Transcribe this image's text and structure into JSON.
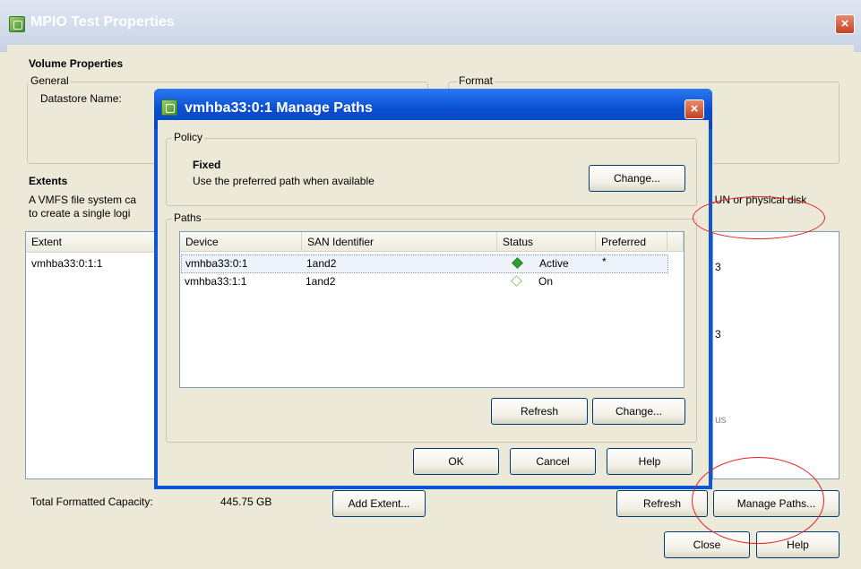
{
  "outer_window": {
    "title": "MPIO Test Properties",
    "volume_properties_heading": "Volume Properties",
    "general_label": "General",
    "datastore_name_label": "Datastore Name:",
    "format_label": "Format",
    "extents_heading": "Extents",
    "extents_desc_line1": "A VMFS file system ca",
    "extents_desc_line2": "to create a single logi",
    "extents_desc_right": "LUN or physical disk",
    "extent_column": "Extent",
    "extent_rows": [
      "vmhba33:0:1:1"
    ],
    "partial_glyph_1": "3",
    "partial_glyph_2": "3",
    "partial_text_us": "us",
    "total_capacity_label": "Total Formatted Capacity:",
    "total_capacity_value": "445.75 GB",
    "add_extent_button": "Add Extent...",
    "refresh_button": "Refresh",
    "manage_paths_button": "Manage Paths...",
    "close_button": "Close",
    "help_button": "Help",
    "close_x": "×"
  },
  "dialog": {
    "title": "vmhba33:0:1 Manage Paths",
    "close_x": "×",
    "policy_label": "Policy",
    "policy_name": "Fixed",
    "policy_desc": "Use the preferred path when available",
    "policy_change_button": "Change...",
    "paths_label": "Paths",
    "columns": {
      "device": "Device",
      "san_identifier": "SAN Identifier",
      "status": "Status",
      "preferred": "Preferred"
    },
    "rows": [
      {
        "device": "vmhba33:0:1",
        "san": "1and2",
        "status": "Active",
        "preferred": "*",
        "status_color": "#2aa12a"
      },
      {
        "device": "vmhba33:1:1",
        "san": "1and2",
        "status": "On",
        "preferred": "",
        "status_color": "#ffffff"
      }
    ],
    "refresh_button": "Refresh",
    "paths_change_button": "Change...",
    "ok_button": "OK",
    "cancel_button": "Cancel",
    "help_button": "Help"
  }
}
